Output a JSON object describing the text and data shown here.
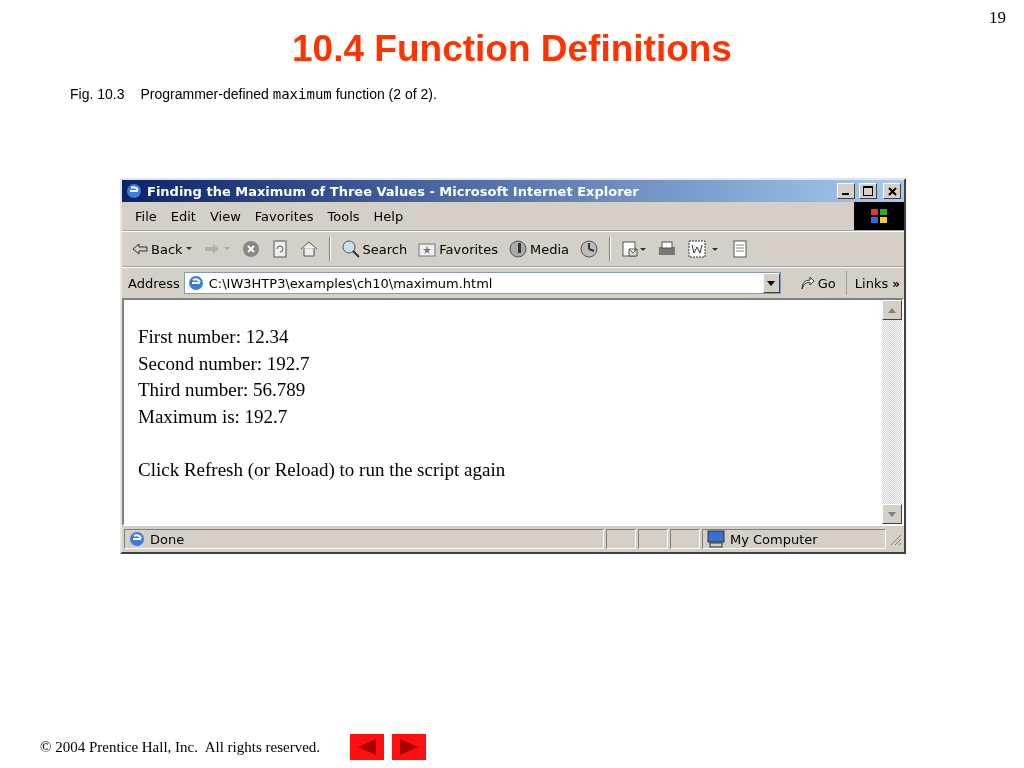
{
  "slide": {
    "page_number": "19",
    "title": "10.4 Function Definitions",
    "caption": {
      "figure": "Fig. 10.3",
      "before": "Programmer-defined ",
      "code": "maximum",
      "after": " function (2 of 2)."
    },
    "footer": "© 2004 Prentice Hall, Inc.  All rights reserved."
  },
  "window": {
    "title": "Finding the Maximum of Three Values - Microsoft Internet Explorer"
  },
  "menu": [
    "File",
    "Edit",
    "View",
    "Favorites",
    "Tools",
    "Help"
  ],
  "toolbar": [
    {
      "kind": "back",
      "label": "Back"
    },
    {
      "kind": "forward"
    },
    {
      "kind": "stop"
    },
    {
      "kind": "refresh"
    },
    {
      "kind": "home"
    },
    {
      "kind": "separator"
    },
    {
      "kind": "search",
      "label": "Search"
    },
    {
      "kind": "favorites",
      "label": "Favorites"
    },
    {
      "kind": "media",
      "label": "Media"
    },
    {
      "kind": "history"
    },
    {
      "kind": "separator"
    },
    {
      "kind": "mail"
    },
    {
      "kind": "print"
    },
    {
      "kind": "edit"
    },
    {
      "kind": "discuss"
    }
  ],
  "address_bar": {
    "label": "Address",
    "value": "C:\\IW3HTP3\\examples\\ch10\\maximum.html",
    "go": "Go",
    "links": "Links",
    "more": "»"
  },
  "content": {
    "lines": [
      "First number: 12.34",
      "Second number: 192.7",
      "Third number: 56.789",
      "Maximum is: 192.7"
    ],
    "note": "Click Refresh (or Reload) to run the script again"
  },
  "status_bar": {
    "text": "Done",
    "zone": "My Computer"
  }
}
